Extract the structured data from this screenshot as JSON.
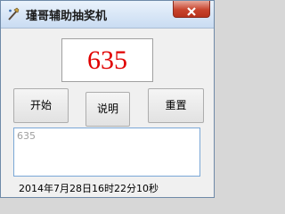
{
  "window": {
    "title": "瑾哥辅助抽奖机"
  },
  "display": {
    "number": "635",
    "number_color": "#e00000"
  },
  "buttons": {
    "start_label": "开始",
    "help_label": "说明",
    "reset_label": "重置"
  },
  "log": {
    "entries": [
      "635"
    ]
  },
  "status": {
    "datetime": "2014年7月28日16时22分10秒"
  },
  "icons": {
    "app": "wand-icon",
    "close": "close-icon"
  }
}
